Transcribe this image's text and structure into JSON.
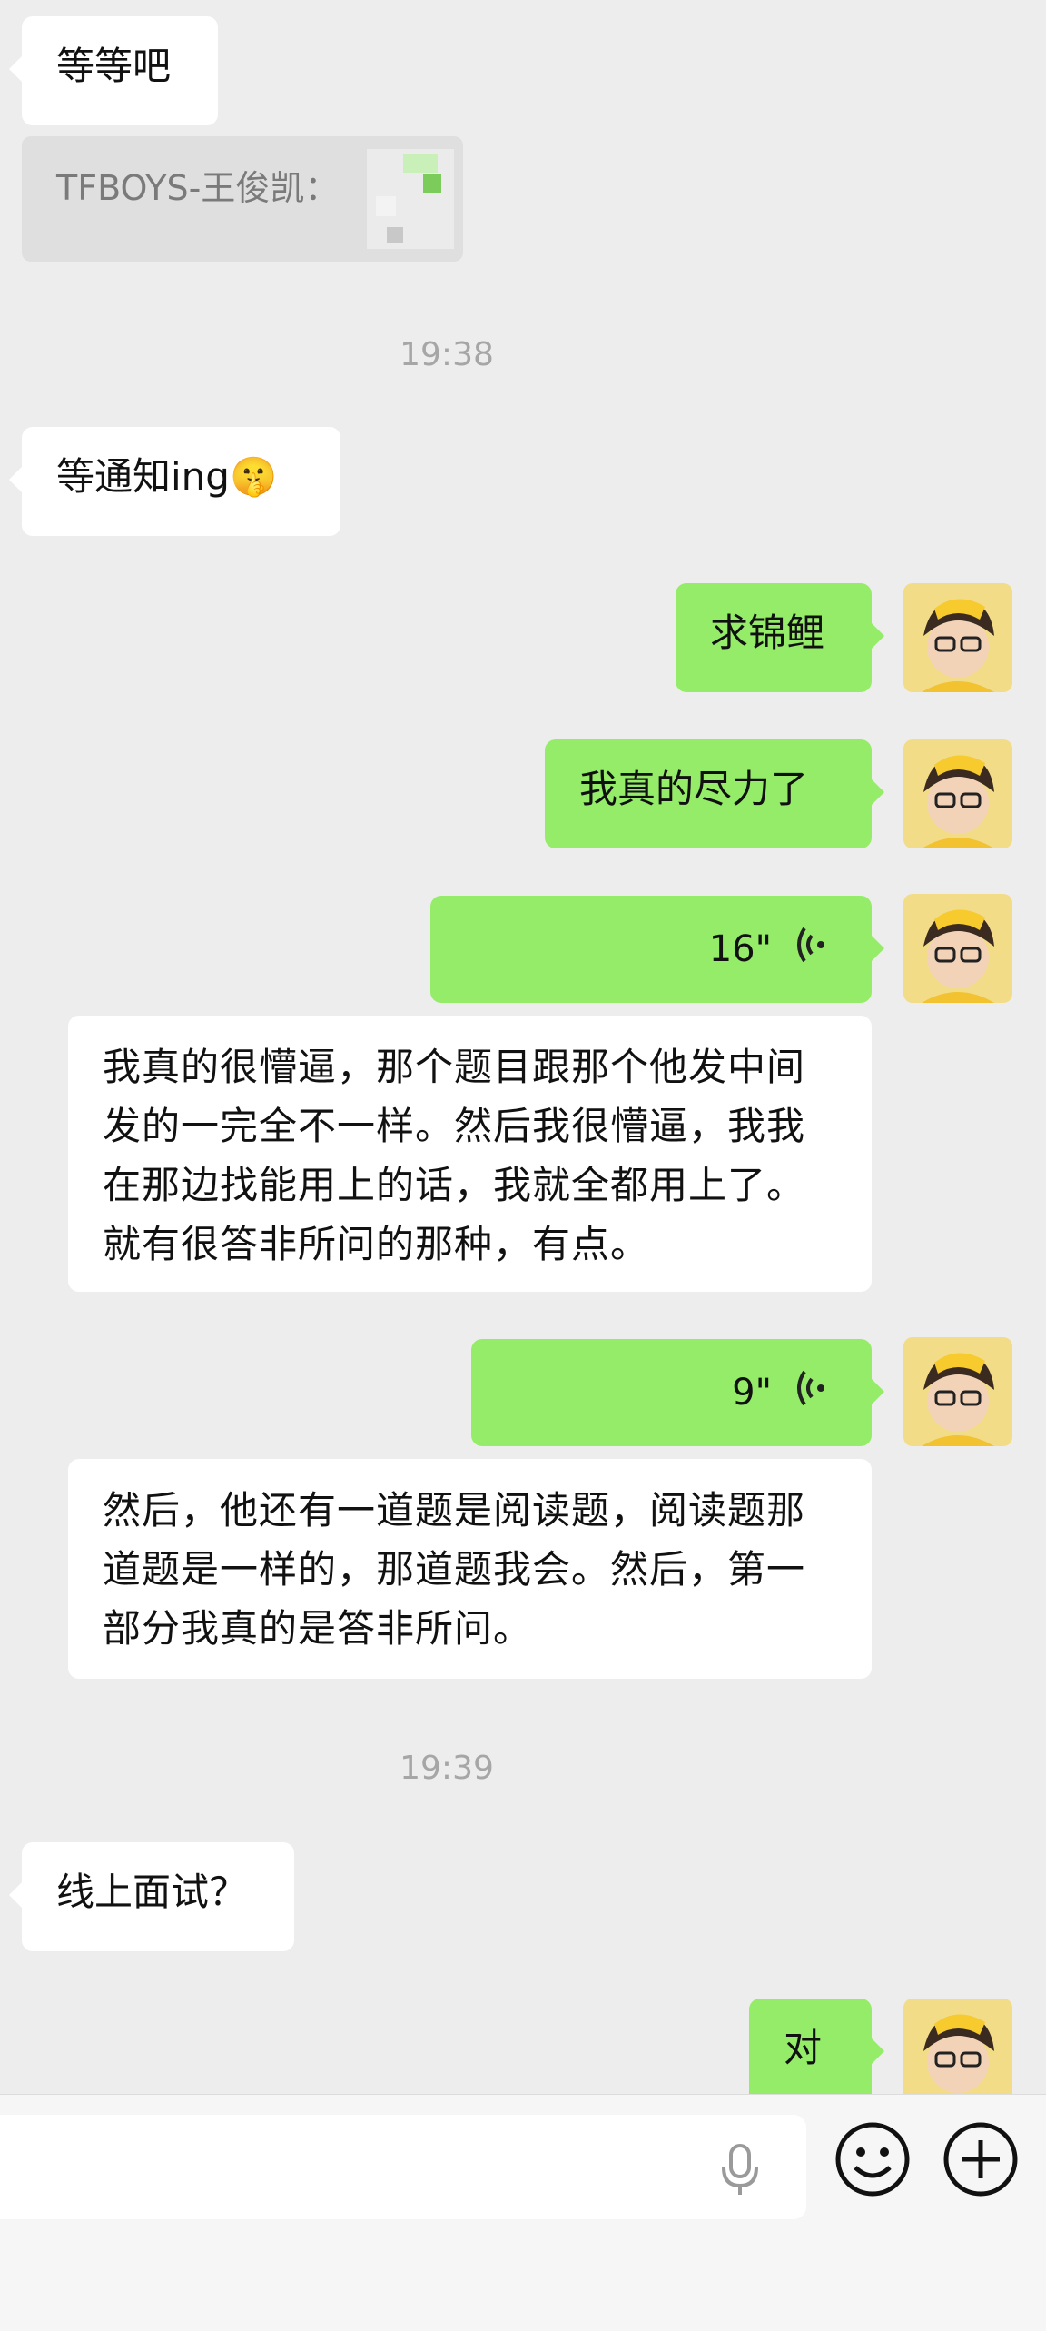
{
  "messages": {
    "m1": "等等吧",
    "quote": "TFBOYS-王俊凯：",
    "time1": "19:38",
    "m2": "等通知ing",
    "m2_emoji": "🤫",
    "m3": "求锦鲤",
    "m4": "我真的尽力了",
    "voice1": {
      "duration": "16\"",
      "transcript": "我真的很懵逼，那个题目跟那个他发中间发的一完全不一样。然后我很懵逼，我我在那边找能用上的话，我就全都用上了。就有很答非所问的那种，有点。"
    },
    "voice2": {
      "duration": "9\"",
      "transcript": "然后，他还有一道题是阅读题，阅读题那道题是一样的，那道题我会。然后，第一部分我真的是答非所问。"
    },
    "time2": "19:39",
    "m5": "线上面试？",
    "m6": "对"
  },
  "icons": {
    "voice_wave": "voice-wave-icon",
    "mic": "microphone-icon",
    "emoji": "emoji-icon",
    "plus": "plus-icon"
  },
  "colors": {
    "background": "#ededed",
    "incoming_bubble": "#ffffff",
    "outgoing_bubble": "#95ec69",
    "timestamp": "#a6a6a6"
  }
}
